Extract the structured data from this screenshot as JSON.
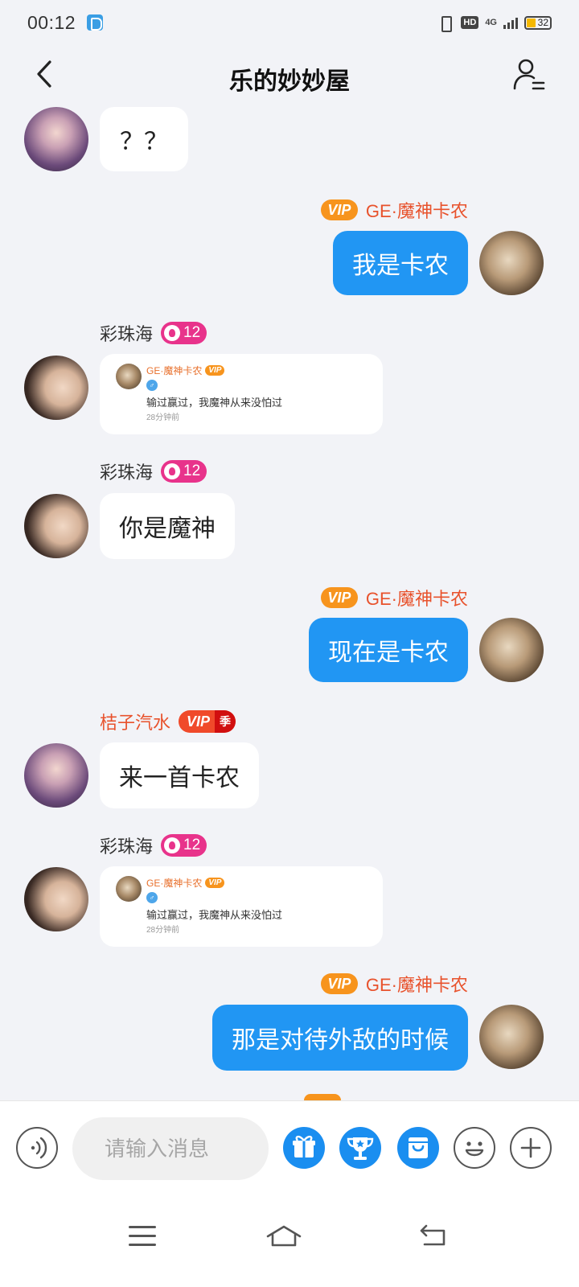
{
  "status": {
    "time": "00:12",
    "network": "4G",
    "hd": "HD",
    "battery": "32"
  },
  "header": {
    "title": "乐的妙妙屋"
  },
  "messages": [
    {
      "side": "left",
      "sender": "",
      "text": "？？"
    },
    {
      "side": "right",
      "sender": "GE·魔神卡农",
      "badge": "VIP",
      "text": "我是卡农"
    },
    {
      "side": "left",
      "sender": "彩珠海",
      "level": "12",
      "card": {
        "name": "GE·魔神卡农",
        "vip": "VIP",
        "gender": "♂",
        "text": "输过赢过，我魔神从来没怕过",
        "time": "28分钟前"
      }
    },
    {
      "side": "left",
      "sender": "彩珠海",
      "level": "12",
      "text": "你是魔神"
    },
    {
      "side": "right",
      "sender": "GE·魔神卡农",
      "badge": "VIP",
      "text": "现在是卡农"
    },
    {
      "side": "left",
      "sender": "桔子汽水",
      "badge": "VIP",
      "season": "季",
      "text": "来一首卡农"
    },
    {
      "side": "left",
      "sender": "彩珠海",
      "level": "12",
      "card": {
        "name": "GE·魔神卡农",
        "vip": "VIP",
        "gender": "♂",
        "text": "输过赢过，我魔神从来没怕过",
        "time": "28分钟前"
      }
    },
    {
      "side": "right",
      "sender": "GE·魔神卡农",
      "badge": "VIP",
      "text": "那是对待外敌的时候"
    }
  ],
  "input": {
    "placeholder": "请输入消息"
  },
  "icons": [
    "back-icon",
    "member-list-icon",
    "voice-icon",
    "gift-icon",
    "trophy-icon",
    "shop-icon",
    "emoji-icon",
    "plus-icon"
  ],
  "colors": {
    "accent": "#2196f3",
    "vip": "#f7941d",
    "level": "#e8338b",
    "sender_highlight": "#e8522c"
  }
}
